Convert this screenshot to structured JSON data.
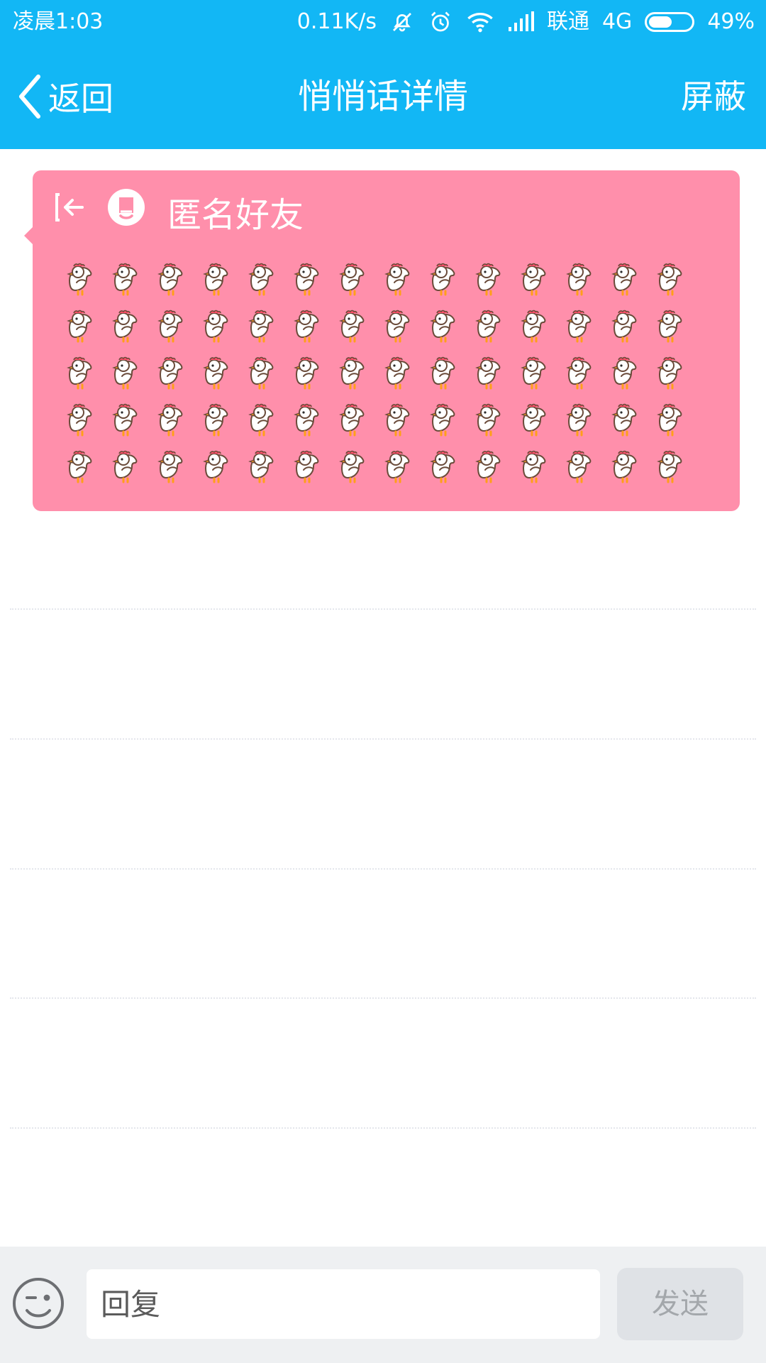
{
  "status_bar": {
    "time": "凌晨1:03",
    "net_speed": "0.11K/s",
    "carrier": "联通",
    "network": "4G",
    "battery": "49%",
    "battery_level": 0.49,
    "icons": [
      "mute-bell-icon",
      "alarm-icon",
      "wifi-icon",
      "signal-icon",
      "battery-icon"
    ]
  },
  "nav": {
    "back_label": "返回",
    "title": "悄悄话详情",
    "action_label": "屏蔽"
  },
  "message": {
    "sender": "匿名好友",
    "bubble_color": "#ff8fab",
    "emoji_name": "chicken",
    "emoji_rows": 5,
    "emoji_per_row": 14
  },
  "reply": {
    "placeholder": "回复",
    "send_label": "发送"
  },
  "colors": {
    "header": "#12b7f5",
    "bottom_bar": "#eef0f2"
  }
}
